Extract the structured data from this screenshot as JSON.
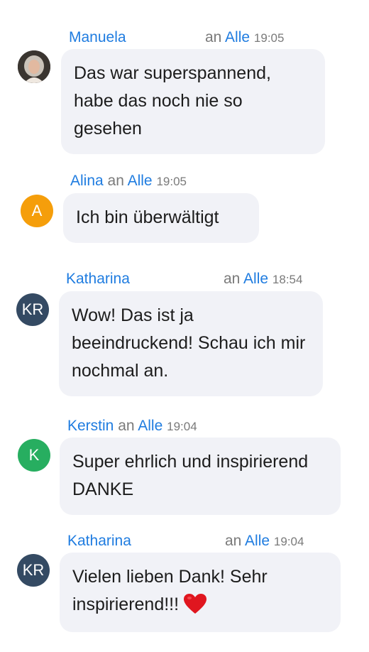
{
  "messages": [
    {
      "sender": "Manuela",
      "an": "an",
      "to": "Alle",
      "time": "19:05",
      "avatar": {
        "type": "photo",
        "color": "#2d2d2d"
      },
      "text": "Das war superspannend, habe das noch nie so gesehen"
    },
    {
      "sender": "Alina",
      "an": "an",
      "to": "Alle",
      "time": "19:05",
      "avatar": {
        "type": "initials",
        "initials": "A",
        "color": "#f59e0b"
      },
      "text": "Ich bin überwältigt"
    },
    {
      "sender": "Katharina",
      "an": "an",
      "to": "Alle",
      "time": "18:54",
      "avatar": {
        "type": "initials",
        "initials": "KR",
        "color": "#344a63"
      },
      "text": "Wow! Das ist ja beeindruckend! Schau ich mir nochmal an."
    },
    {
      "sender": "Kerstin",
      "an": "an",
      "to": "Alle",
      "time": "19:04",
      "avatar": {
        "type": "initials",
        "initials": "K",
        "color": "#27ae60"
      },
      "text": "Super ehrlich und inspirierend DANKE"
    },
    {
      "sender": "Katharina",
      "an": "an",
      "to": "Alle",
      "time": "19:04",
      "avatar": {
        "type": "initials",
        "initials": "KR",
        "color": "#344a63"
      },
      "text": "Vielen lieben Dank! Sehr inspirierend!!!",
      "emoji": "heart-icon"
    }
  ]
}
